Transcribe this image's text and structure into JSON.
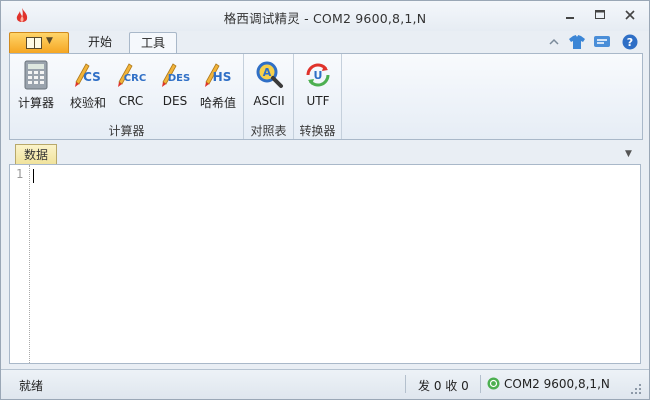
{
  "window": {
    "title": "格西调试精灵 - COM2  9600,8,1,N"
  },
  "ribbon_tabs": [
    {
      "label": "开始"
    },
    {
      "label": "工具"
    }
  ],
  "ribbon_groups": [
    {
      "label": "计算器",
      "buttons": [
        {
          "label": "计算器",
          "icon": "calculator-icon"
        },
        {
          "label": "校验和",
          "icon": "checksum-icon",
          "badge": "CS"
        },
        {
          "label": "CRC",
          "icon": "crc-icon",
          "badge": "CRC"
        },
        {
          "label": "DES",
          "icon": "des-icon",
          "badge": "DES"
        },
        {
          "label": "哈希值",
          "icon": "hash-icon",
          "badge": "HS"
        }
      ]
    },
    {
      "label": "对照表",
      "buttons": [
        {
          "label": "ASCII",
          "icon": "ascii-magnifier-icon",
          "badge": "A"
        }
      ]
    },
    {
      "label": "转换器",
      "buttons": [
        {
          "label": "UTF",
          "icon": "utf-convert-icon",
          "badge": "U"
        }
      ]
    }
  ],
  "document": {
    "tab_label": "数据",
    "line_numbers": [
      "1"
    ]
  },
  "status": {
    "ready": "就绪",
    "counts": "发 0  收 0",
    "port": "COM2  9600,8,1,N"
  },
  "colors": {
    "app_menu": "#f5a623",
    "accent_blue": "#2f6fc6",
    "icon_red": "#e0322b",
    "status_green": "#4caf50"
  }
}
